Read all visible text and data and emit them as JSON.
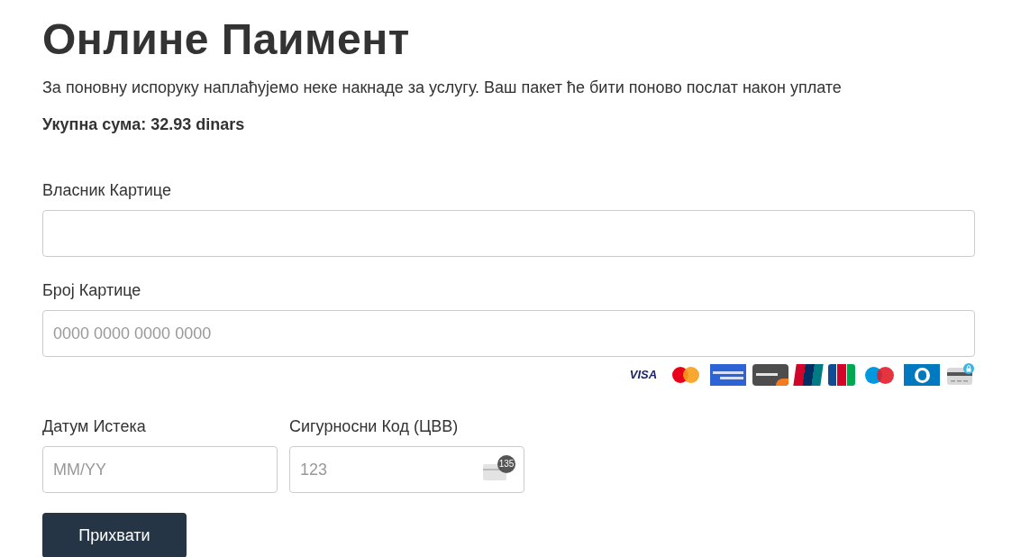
{
  "title": "Онлине Паимент",
  "description": "За поновну испоруку наплаћујемо неке накнаде за услугу. Ваш пакет ће бити поново послат након уплате",
  "total": "Укупна сума: 32.93 dinars",
  "fields": [
    {
      "label": "Власник Картице"
    },
    {
      "label": "Број Картице",
      "placeholder": "0000 0000 0000 0000"
    }
  ],
  "card_logos": [
    {
      "kind": "visa",
      "label": "VISA"
    },
    {
      "kind": "mastercard"
    },
    {
      "kind": "amex"
    },
    {
      "kind": "discover"
    },
    {
      "kind": "unionpay"
    },
    {
      "kind": "jcb"
    },
    {
      "kind": "maestro"
    },
    {
      "kind": "diners"
    },
    {
      "kind": "generic"
    }
  ],
  "expiry": {
    "label": "Датум Истека",
    "placeholder": "MM/YY"
  },
  "cvv": {
    "label": "Сигурносни Код (ЦВВ)",
    "placeholder": "123",
    "badge": "135"
  },
  "submit": "Прихвати"
}
